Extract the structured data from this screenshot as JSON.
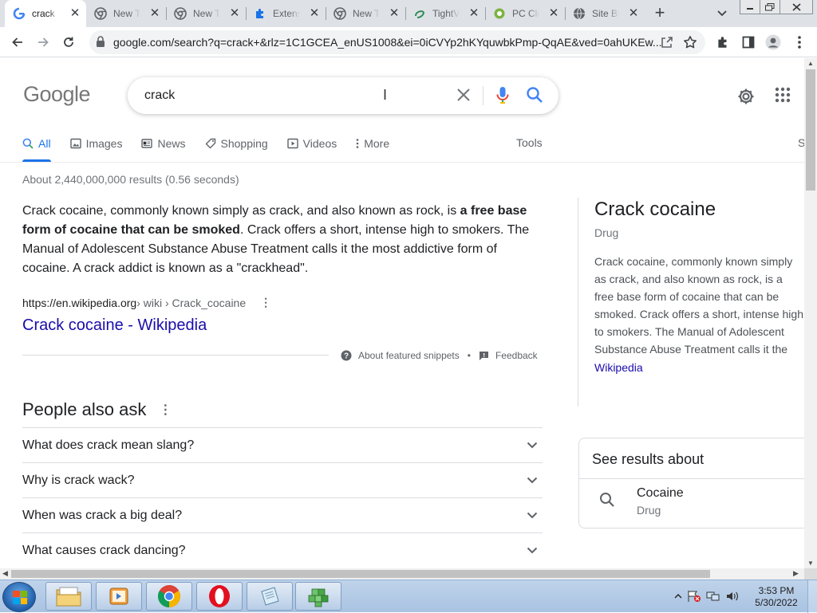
{
  "browser": {
    "tabs": [
      {
        "title": "crack -",
        "icon": "google-icon",
        "active": true
      },
      {
        "title": "New Ta",
        "icon": "chrome-icon",
        "active": false
      },
      {
        "title": "New Ta",
        "icon": "chrome-icon",
        "active": false
      },
      {
        "title": "Extensi",
        "icon": "puzzle-icon",
        "active": false
      },
      {
        "title": "New Ta",
        "icon": "chrome-icon",
        "active": false
      },
      {
        "title": "TightV",
        "icon": "tightvnc-icon",
        "active": false
      },
      {
        "title": "PC Cle",
        "icon": "pc-cleaner-icon",
        "active": false
      },
      {
        "title": "Site Bl",
        "icon": "globe-icon",
        "active": false
      }
    ],
    "url": "google.com/search?q=crack+&rlz=1C1GCEA_enUS1008&ei=0iCVYp2hKYquwbkPmp-QqAE&ved=0ahUKEw..."
  },
  "search": {
    "logo": "Google",
    "query": "crack",
    "tabs": [
      "All",
      "Images",
      "News",
      "Shopping",
      "Videos",
      "More"
    ],
    "tools": "Tools",
    "safesearch_partial": "S",
    "stats": "About 2,440,000,000 results (0.56 seconds)"
  },
  "snippet": {
    "text_before": "Crack cocaine, commonly known simply as crack, and also known as rock, is ",
    "text_bold": "a free base form of cocaine that can be smoked",
    "text_after": ". Crack offers a short, intense high to smokers. The Manual of Adolescent Substance Abuse Treatment calls it the most addictive form of cocaine. A crack addict is known as a \"crackhead\".",
    "cite_domain": "https://en.wikipedia.org",
    "cite_path": " › wiki › Crack_cocaine",
    "result_title": "Crack cocaine - Wikipedia",
    "about": "About featured snippets",
    "bullet": "•",
    "feedback": "Feedback"
  },
  "people_also_ask": {
    "heading": "People also ask",
    "questions": [
      "What does crack mean slang?",
      "Why is crack wack?",
      "When was crack a big deal?",
      "What causes crack dancing?"
    ]
  },
  "knowledge_panel": {
    "title": "Crack cocaine",
    "subtitle": "Drug",
    "description": "Crack cocaine, commonly known simply as crack, and also known as rock, is a free base form of cocaine that can be smoked. Crack offers a short, intense high to smokers. The Manual of Adolescent Substance Abuse Treatment calls it the most addictive form of cocaine. A crack addict is known as a \"crackhead\".",
    "source": "Wikipedia"
  },
  "see_results_about": {
    "heading": "See results about",
    "items": [
      {
        "name": "Cocaine",
        "type": "Drug"
      }
    ]
  },
  "taskbar": {
    "time": "3:53 PM",
    "date": "5/30/2022",
    "apps": [
      "explorer-icon",
      "media-player-icon",
      "chrome-icon",
      "opera-icon",
      "notepad-icon",
      "cube-app-icon"
    ]
  },
  "colors": {
    "link": "#1a0dab",
    "accent": "#1a73e8",
    "tab_strip": "#dee1e6",
    "taskbar": "#a9c3e2"
  }
}
